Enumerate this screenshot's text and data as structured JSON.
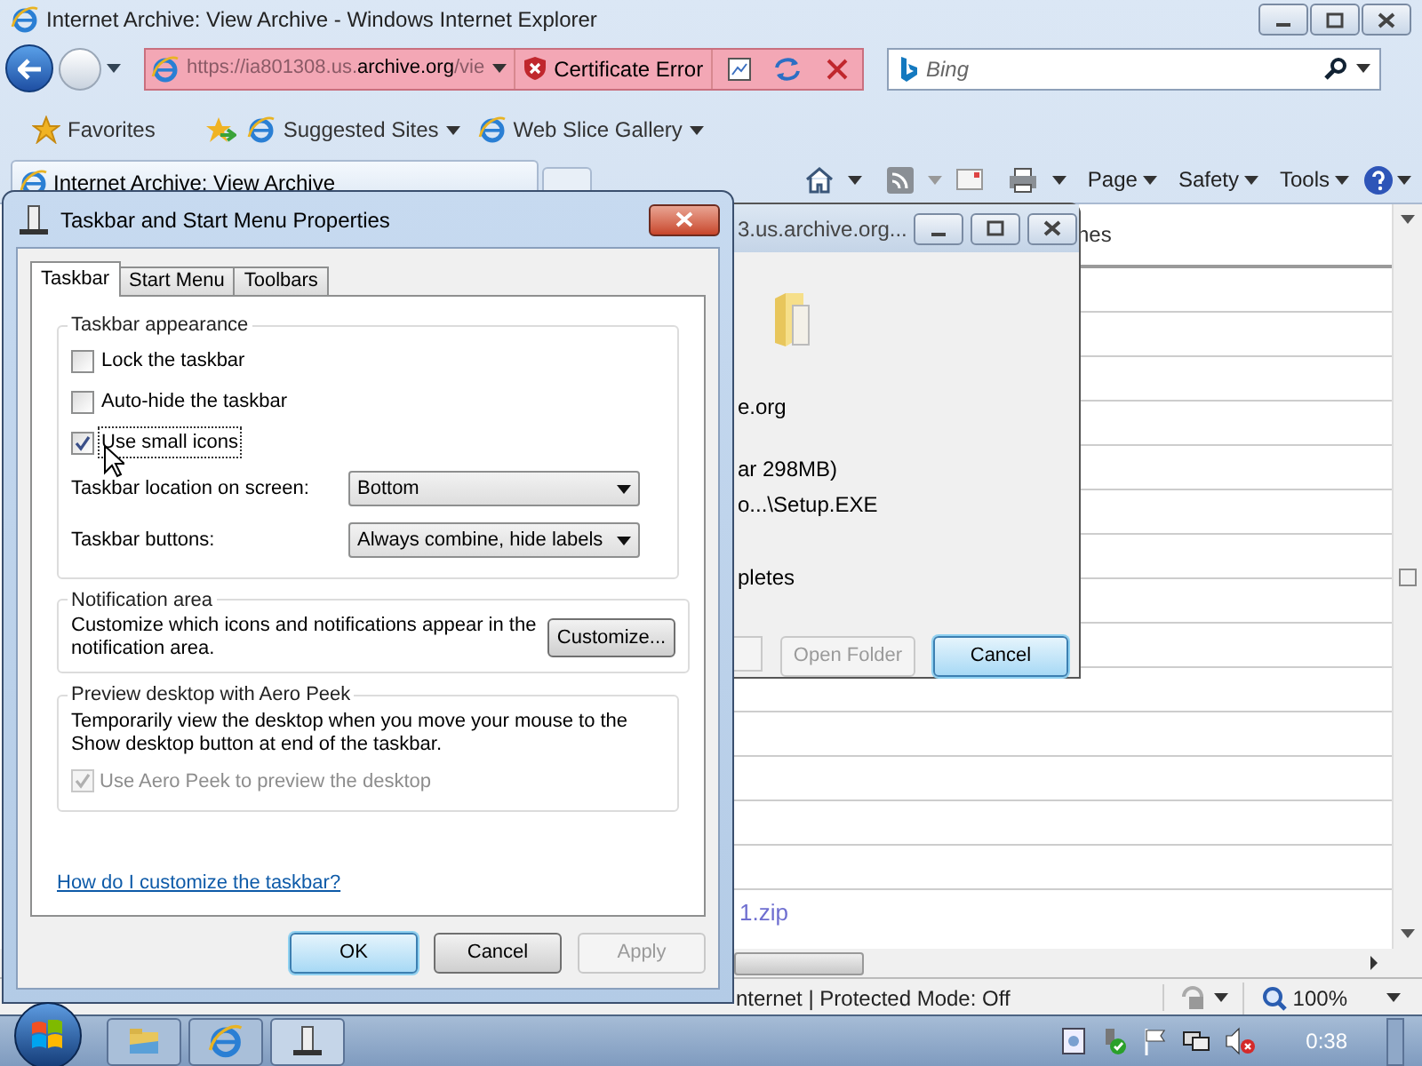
{
  "ie": {
    "title": "Internet Archive: View Archive - Windows Internet Explorer",
    "address": {
      "url_start": "https://ia801308.us.",
      "url_domain": "archive.org",
      "url_end": "/vie",
      "certificate": "Certificate Error"
    },
    "search": {
      "placeholder": "Bing"
    },
    "favorites": {
      "label": "Favorites",
      "links": [
        "Suggested Sites",
        "Web Slice Gallery"
      ]
    },
    "tab": {
      "label": "Internet Archive: View Archive"
    },
    "commands": [
      "Page",
      "Safety",
      "Tools"
    ],
    "content": {
      "header_fragment": "nes",
      "link_fragment": "1.zip"
    },
    "status": {
      "text": "nternet | Protected Mode: Off",
      "zoom": "100%"
    }
  },
  "download": {
    "title": "3.us.archive.org...",
    "lines": [
      "e.org",
      "ar 298MB)",
      "o...\\Setup.EXE",
      "pletes"
    ],
    "buttons": [
      {
        "label": "Open Folder",
        "disabled": true,
        "default": false
      },
      {
        "label": "Cancel",
        "disabled": false,
        "default": true
      }
    ]
  },
  "dialog": {
    "title": "Taskbar and Start Menu Properties",
    "tabs": [
      {
        "label": "Taskbar",
        "selected": true
      },
      {
        "label": "Start Menu",
        "selected": false
      },
      {
        "label": "Toolbars",
        "selected": false
      }
    ],
    "appearance": {
      "legend": "Taskbar appearance",
      "checkboxes": [
        {
          "label": "Lock the taskbar",
          "checked": false,
          "focused": false
        },
        {
          "label": "Auto-hide the taskbar",
          "checked": false,
          "focused": false
        },
        {
          "label": "Use small icons",
          "checked": true,
          "focused": true
        }
      ],
      "selects": [
        {
          "label": "Taskbar location on screen:",
          "value": "Bottom"
        },
        {
          "label": "Taskbar buttons:",
          "value": "Always combine, hide labels"
        }
      ]
    },
    "notification": {
      "legend": "Notification area",
      "text": "Customize which icons and notifications appear in the notification area.",
      "button": "Customize..."
    },
    "peek": {
      "legend": "Preview desktop with Aero Peek",
      "text": "Temporarily view the desktop when you move your mouse to the Show desktop button at end of the taskbar.",
      "checkbox": {
        "label": "Use Aero Peek to preview the desktop",
        "checked": true,
        "disabled": true
      }
    },
    "help_link": "How do I customize the taskbar?",
    "buttons": [
      {
        "label": "OK",
        "default": true,
        "disabled": false
      },
      {
        "label": "Cancel",
        "default": false,
        "disabled": false
      },
      {
        "label": "Apply",
        "default": false,
        "disabled": true
      }
    ]
  },
  "taskbar": {
    "clock": "0:38"
  }
}
